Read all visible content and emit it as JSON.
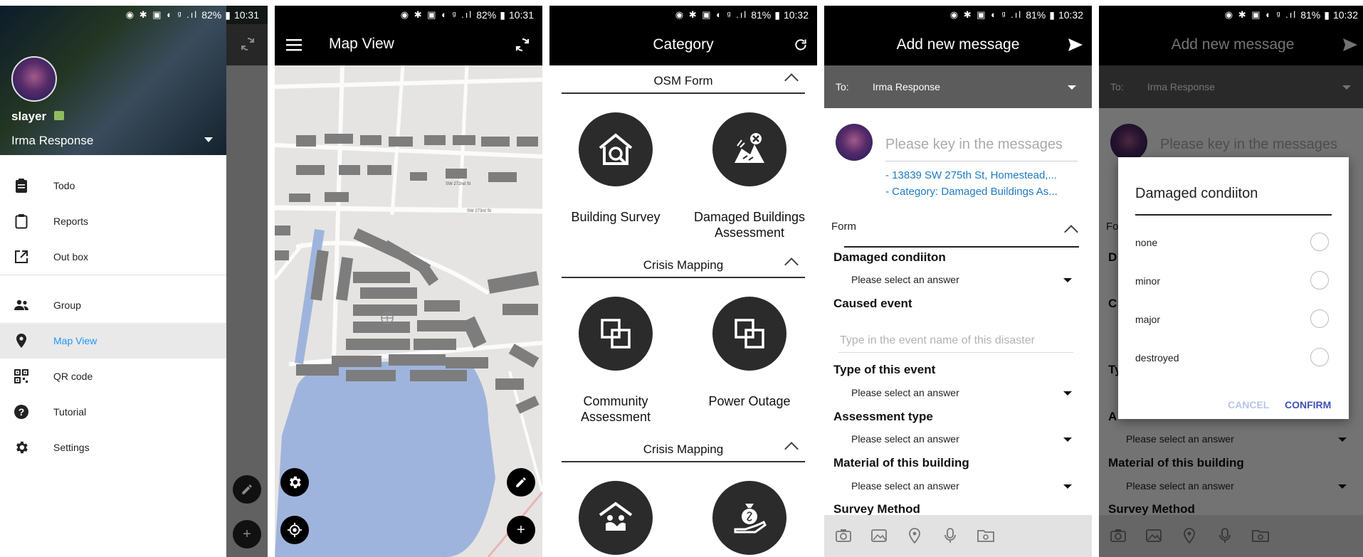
{
  "status_bar": {
    "s1": {
      "battery": "82%",
      "time": "10:31"
    },
    "s2": {
      "battery": "82%",
      "time": "10:31"
    },
    "s3": {
      "battery": "81%",
      "time": "10:32"
    },
    "s4": {
      "battery": "81%",
      "time": "10:32"
    },
    "s5": {
      "battery": "81%",
      "time": "10:32"
    }
  },
  "drawer": {
    "username": "slayer",
    "organization": "Irma Response",
    "items": [
      {
        "label": "Todo",
        "icon": "clipboard-icon"
      },
      {
        "label": "Reports",
        "icon": "clipboard-outline-icon"
      },
      {
        "label": "Out box",
        "icon": "open-in-new-icon"
      },
      {
        "label": "Group",
        "icon": "people-icon"
      },
      {
        "label": "Map View",
        "icon": "location-pin-icon",
        "active": true
      },
      {
        "label": "QR code",
        "icon": "qr-code-icon"
      },
      {
        "label": "Tutorial",
        "icon": "help-icon"
      },
      {
        "label": "Settings",
        "icon": "gear-icon"
      }
    ]
  },
  "map_view": {
    "title": "Map View"
  },
  "category": {
    "title": "Category",
    "sections": [
      {
        "title": "OSM Form",
        "items": [
          "Building Survey",
          "Damaged Buildings Assessment"
        ]
      },
      {
        "title": "Crisis Mapping",
        "items": [
          "Community Assessment",
          "Power Outage"
        ]
      },
      {
        "title": "Crisis Mapping",
        "items": [
          "",
          ""
        ]
      }
    ]
  },
  "message": {
    "title": "Add new message",
    "to_label": "To:",
    "to_value": "Irma Response",
    "placeholder": "Please key in the messages",
    "attachments": [
      "- 13839 SW 275th St, Homestead,...",
      "- Category: Damaged Buildings As..."
    ],
    "form_label": "Form",
    "fields": [
      {
        "label": "Damaged condiiton",
        "value": "Please select an answer"
      },
      {
        "label": "Caused event",
        "placeholder": "Type in the event name of this disaster"
      },
      {
        "label": "Type of this event",
        "value": "Please select an answer"
      },
      {
        "label": "Assessment type",
        "value": "Please select an answer"
      },
      {
        "label": "Material of this building",
        "value": "Please select an answer"
      },
      {
        "label": "Survey Method"
      }
    ]
  },
  "dialog": {
    "title": "Damaged condiiton",
    "options": [
      "none",
      "minor",
      "major",
      "destroyed"
    ],
    "cancel": "CANCEL",
    "confirm": "CONFIRM",
    "partial_labels": {
      "form": "Fo",
      "damaged": "D",
      "caused": "C",
      "type": "Ty",
      "assessment": "A"
    }
  },
  "colors": {
    "appbar": "#000000",
    "accent": "#2196f3",
    "link": "#1f7bc2",
    "dialog_confirm": "#3f51b5",
    "dialog_cancel": "#b8c6e8",
    "to_bar": "#5c5c5c",
    "water": "#9fb4dc"
  }
}
